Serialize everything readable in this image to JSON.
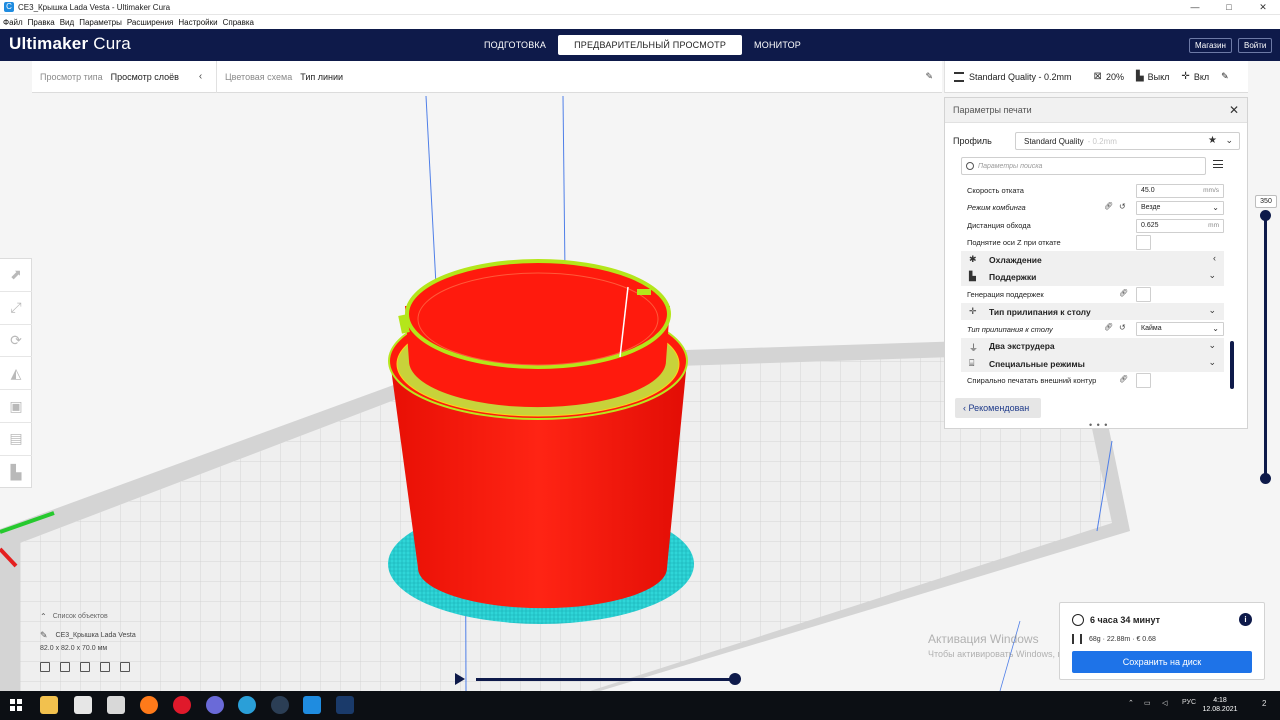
{
  "window": {
    "title": "CE3_Крышка Lada Vesta - Ultimaker Cura",
    "controls": [
      "—",
      "□",
      "✕"
    ]
  },
  "menubar": [
    "Файл",
    "Правка",
    "Вид",
    "Параметры",
    "Расширения",
    "Настройки",
    "Справка"
  ],
  "header": {
    "logo_main": "Ultimaker",
    "logo_sub": "Cura",
    "stages": [
      "ПОДГОТОВКА",
      "ПРЕДВАРИТЕЛЬНЫЙ ПРОСМОТР",
      "МОНИТОР"
    ],
    "active_stage": 1,
    "marketplace": "Магазин",
    "signin": "Войти"
  },
  "viewbar": {
    "view_type_label": "Просмотр типа",
    "view_type_value": "Просмотр слоёв",
    "color_scheme_label": "Цветовая схема",
    "color_scheme_value": "Тип линии"
  },
  "quality": {
    "profile": "Standard Quality - 0.2mm",
    "infill": "20%",
    "support": "Выкл",
    "adhesion": "Вкл"
  },
  "settings_panel": {
    "title": "Параметры печати",
    "profile_label": "Профиль",
    "profile_value": "Standard Quality",
    "profile_dim": "- 0.2mm",
    "search_placeholder": "Параметры поиска",
    "rows": [
      {
        "type": "setting",
        "label": "Скорость отката",
        "value": "45.0",
        "unit": "mm/s",
        "italic": false,
        "control": "input"
      },
      {
        "type": "setting",
        "label": "Режим комбинга",
        "value": "Везде",
        "italic": true,
        "control": "select",
        "linked": true,
        "reset": true
      },
      {
        "type": "setting",
        "label": "Дистанция обхода",
        "value": "0.625",
        "unit": "mm",
        "italic": false,
        "control": "input"
      },
      {
        "type": "setting",
        "label": "Поднятие оси Z при откате",
        "italic": false,
        "control": "checkbox"
      },
      {
        "type": "category",
        "label": "Охлаждение",
        "icon": "fan-icon",
        "glyph": "✱",
        "expanded": false
      },
      {
        "type": "category",
        "label": "Поддержки",
        "icon": "support-icon",
        "glyph": "▙",
        "expanded": true
      },
      {
        "type": "setting",
        "label": "Генерация поддержек",
        "italic": false,
        "control": "checkbox",
        "linked": true
      },
      {
        "type": "category",
        "label": "Тип прилипания к столу",
        "icon": "adhesion-icon",
        "glyph": "✛",
        "expanded": true
      },
      {
        "type": "setting",
        "label": "Тип прилипания к столу",
        "value": "Кайма",
        "italic": true,
        "control": "select",
        "linked": true,
        "reset": true
      },
      {
        "type": "category",
        "label": "Два экструдера",
        "icon": "dual-extruder-icon",
        "glyph": "⏚",
        "expanded": true
      },
      {
        "type": "category",
        "label": "Специальные режимы",
        "icon": "special-modes-icon",
        "glyph": "⌸",
        "expanded": true
      },
      {
        "type": "setting",
        "label": "Спирально печатать внешний контур",
        "italic": false,
        "control": "checkbox",
        "linked": true
      }
    ],
    "recommended": "Рекомендован"
  },
  "layer_slider": {
    "max_layer": "350"
  },
  "object_list": {
    "header": "Список объектов",
    "object_name": "CE3_Крышка Lada Vesta",
    "dimensions": "82.0 x 82.0 x 70.0 мм"
  },
  "estimate": {
    "time": "6 часа 34 минут",
    "material": "68g · 22.88m · € 0.68",
    "save": "Сохранить на диск"
  },
  "watermark": {
    "line1": "Активация Windows",
    "line2": "Чтобы активировать Windows, перейдите в раздел \"Параметры\"."
  },
  "taskbar": {
    "lang": "РУС",
    "time": "4:18",
    "date": "12.08.2021",
    "notifications": "2"
  },
  "colors": {
    "header_bg": "#0e1a4a",
    "print_body": "#ff1a0d",
    "skirt": "#24d2d4",
    "infill_top": "#b4e61a",
    "accent_button": "#1e73e8"
  }
}
